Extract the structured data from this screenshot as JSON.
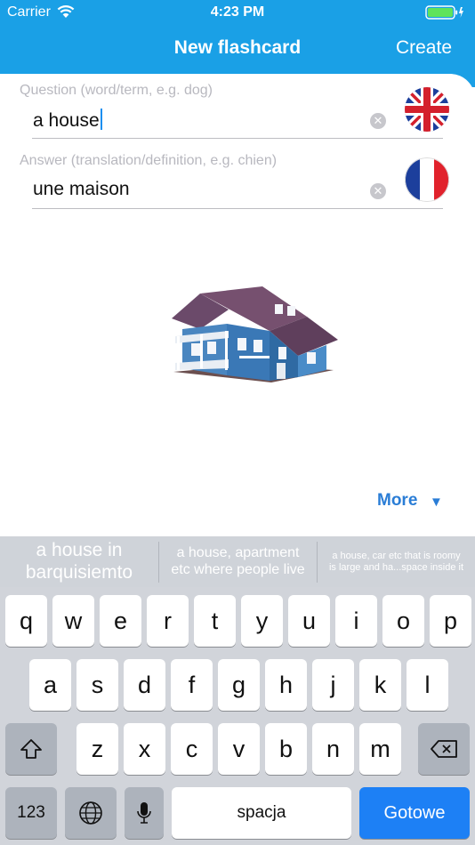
{
  "status_bar": {
    "carrier": "Carrier",
    "time": "4:23 PM"
  },
  "nav": {
    "title": "New flashcard",
    "create_label": "Create"
  },
  "form": {
    "question_label": "Question (word/term, e.g. dog)",
    "question_value": "a house",
    "answer_label": "Answer (translation/definition, e.g. chien)",
    "answer_value": "une maison"
  },
  "more_label": "More",
  "predictions": [
    {
      "line1": "a house in",
      "line2": "barquisiemto"
    },
    {
      "line1": "a house, apartment",
      "line2": "etc where people live"
    },
    {
      "line1": "a house, car etc that is roomy",
      "line2": "is large and ha...space inside it"
    }
  ],
  "keyboard": {
    "row1": [
      "q",
      "w",
      "e",
      "r",
      "t",
      "y",
      "u",
      "i",
      "o",
      "p"
    ],
    "row2": [
      "a",
      "s",
      "d",
      "f",
      "g",
      "h",
      "j",
      "k",
      "l"
    ],
    "row3": [
      "z",
      "x",
      "c",
      "v",
      "b",
      "n",
      "m"
    ],
    "numbers_label": "123",
    "space_label": "spacja",
    "return_label": "Gotowe"
  },
  "colors": {
    "header": "#1aa0e6",
    "accent": "#2a7dd6",
    "return_key": "#1d80f5"
  },
  "icons": [
    "wifi-icon",
    "battery-icon",
    "clear-icon",
    "uk-flag-icon",
    "france-flag-icon",
    "house-image",
    "shift-icon",
    "backspace-icon",
    "globe-icon",
    "microphone-icon",
    "triangle-down-icon"
  ]
}
